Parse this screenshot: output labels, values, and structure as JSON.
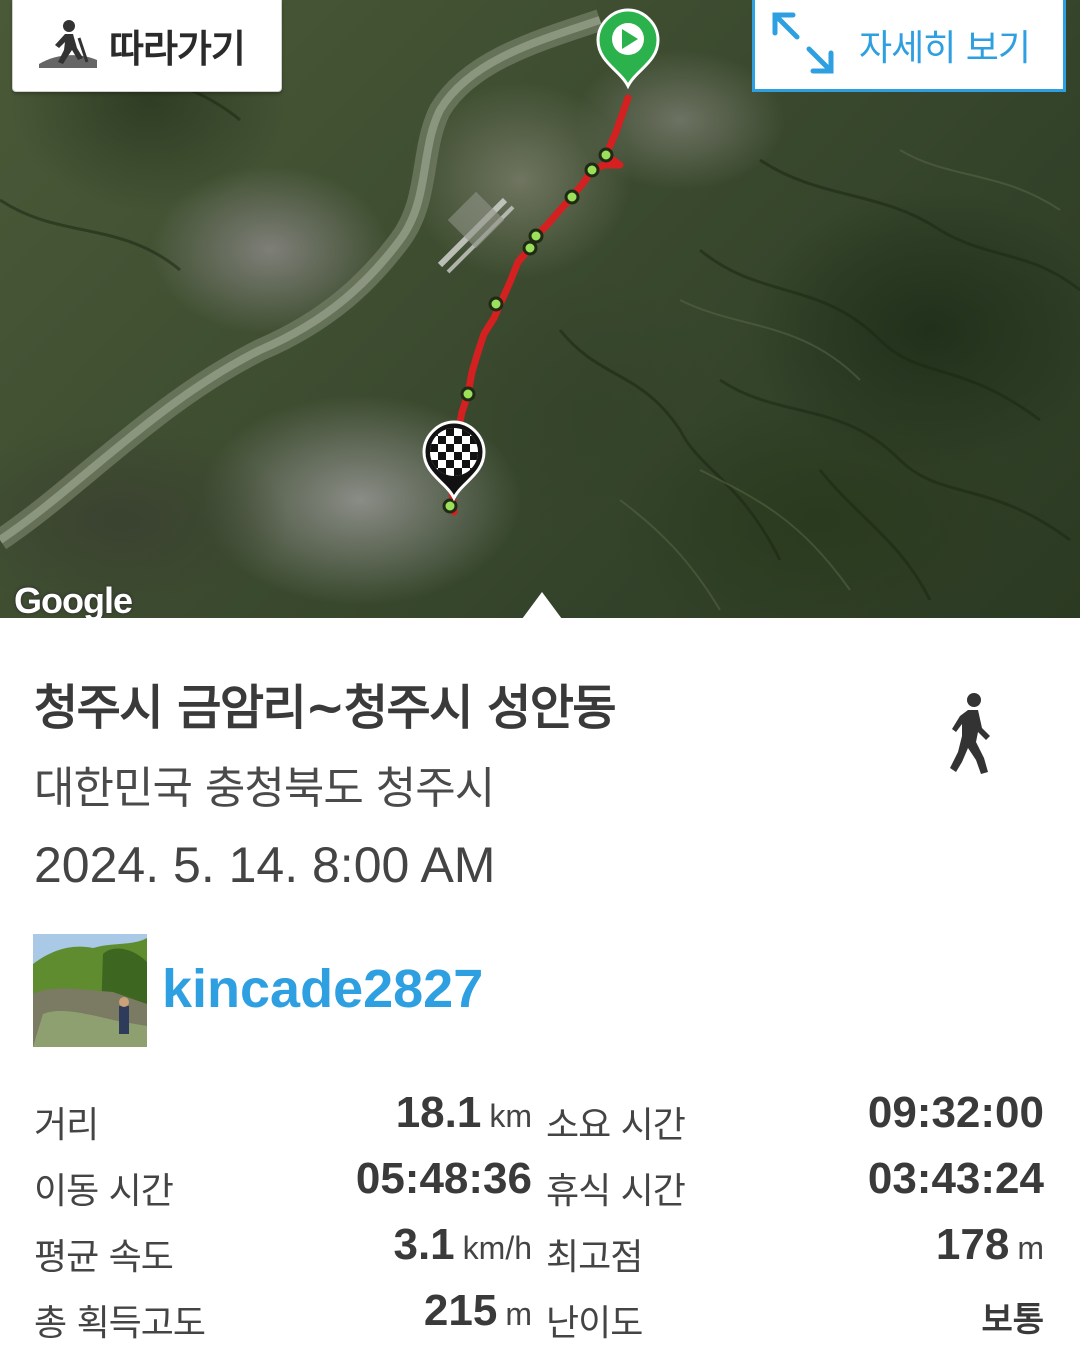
{
  "map": {
    "follow_button_label": "따라가기",
    "detail_button_label": "자세히 보기",
    "google_logo": "Google",
    "icons": {
      "follow": "hiker-icon",
      "expand": "expand-arrows-icon",
      "start": "play-marker-icon",
      "finish": "checkered-flag-marker-icon"
    },
    "colors": {
      "route": "#d42020",
      "waypoint": "#9be05a",
      "start_marker": "#2bb24c",
      "accent": "#2e9fe0"
    }
  },
  "track": {
    "title": "청주시 금암리~청주시 성안동",
    "region": "대한민국 충청북도 청주시",
    "datetime": "2024. 5. 14. 8:00 AM",
    "activity_icon": "walking-person-icon"
  },
  "user": {
    "username": "kincade2827"
  },
  "stats": [
    {
      "left_label": "거리",
      "left_value": "18.1",
      "left_unit": "km",
      "right_label": "소요 시간",
      "right_value": "09:32:00",
      "right_unit": ""
    },
    {
      "left_label": "이동 시간",
      "left_value": "05:48:36",
      "left_unit": "",
      "right_label": "휴식 시간",
      "right_value": "03:43:24",
      "right_unit": ""
    },
    {
      "left_label": "평균 속도",
      "left_value": "3.1",
      "left_unit": "km/h",
      "right_label": "최고점",
      "right_value": "178",
      "right_unit": "m"
    },
    {
      "left_label": "총 획득고도",
      "left_value": "215",
      "left_unit": "m",
      "right_label": "난이도",
      "right_value": "보통",
      "right_unit": ""
    }
  ]
}
